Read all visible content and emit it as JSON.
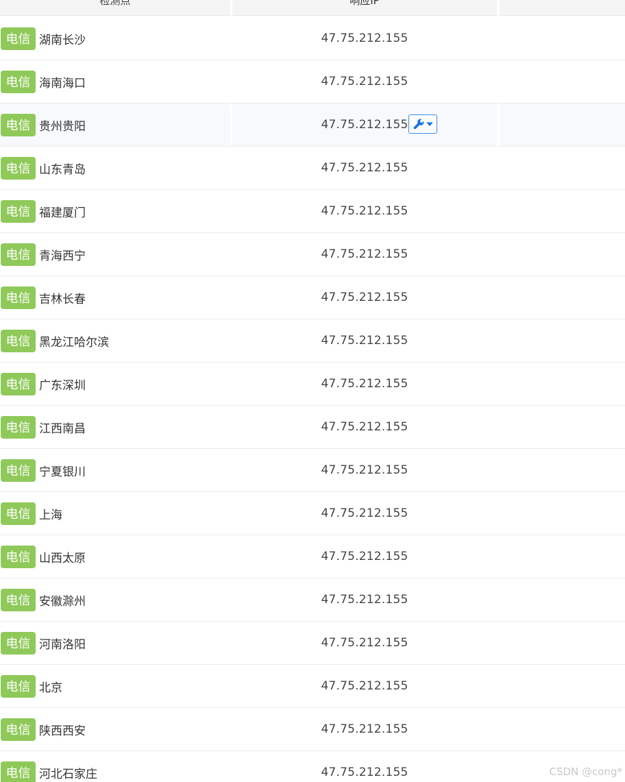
{
  "table": {
    "columns": [
      {
        "label": "检测点"
      },
      {
        "label": "响应IP"
      },
      {
        "label": ""
      }
    ],
    "rows": [
      {
        "isp": "电信",
        "location": "湖南长沙",
        "ip": "47.75.212.155"
      },
      {
        "isp": "电信",
        "location": "海南海口",
        "ip": "47.75.212.155"
      },
      {
        "isp": "电信",
        "location": "贵州贵阳",
        "ip": "47.75.212.155",
        "tool": true
      },
      {
        "isp": "电信",
        "location": "山东青岛",
        "ip": "47.75.212.155"
      },
      {
        "isp": "电信",
        "location": "福建厦门",
        "ip": "47.75.212.155"
      },
      {
        "isp": "电信",
        "location": "青海西宁",
        "ip": "47.75.212.155"
      },
      {
        "isp": "电信",
        "location": "吉林长春",
        "ip": "47.75.212.155"
      },
      {
        "isp": "电信",
        "location": "黑龙江哈尔滨",
        "ip": "47.75.212.155"
      },
      {
        "isp": "电信",
        "location": "广东深圳",
        "ip": "47.75.212.155"
      },
      {
        "isp": "电信",
        "location": "江西南昌",
        "ip": "47.75.212.155"
      },
      {
        "isp": "电信",
        "location": "宁夏银川",
        "ip": "47.75.212.155"
      },
      {
        "isp": "电信",
        "location": "上海",
        "ip": "47.75.212.155"
      },
      {
        "isp": "电信",
        "location": "山西太原",
        "ip": "47.75.212.155"
      },
      {
        "isp": "电信",
        "location": "安徽滁州",
        "ip": "47.75.212.155"
      },
      {
        "isp": "电信",
        "location": "河南洛阳",
        "ip": "47.75.212.155"
      },
      {
        "isp": "电信",
        "location": "北京",
        "ip": "47.75.212.155"
      },
      {
        "isp": "电信",
        "location": "陕西西安",
        "ip": "47.75.212.155"
      },
      {
        "isp": "电信",
        "location": "河北石家庄",
        "ip": "47.75.212.155"
      }
    ]
  },
  "icons": {
    "tool": "wrench-icon",
    "dropdown": "caret-down-icon"
  },
  "colors": {
    "badge": "#8fc95a",
    "tool_accent": "#1a73e8",
    "highlight_row": "#f7f9fc"
  },
  "watermark": "CSDN @cong*"
}
